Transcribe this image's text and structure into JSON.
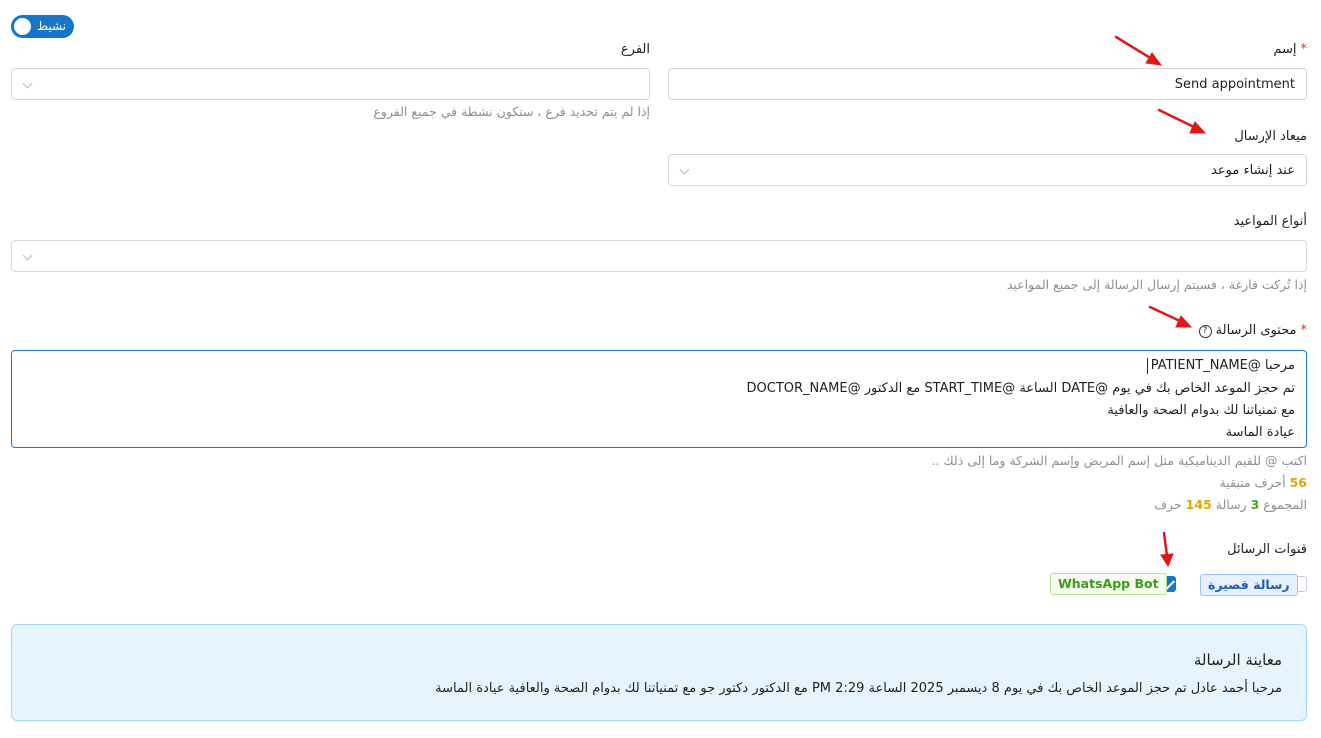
{
  "status_toggle": {
    "label": "نشيط",
    "on": true
  },
  "name_field": {
    "label": "إسم",
    "required_mark": "*",
    "value": "Send appointment"
  },
  "branch_field": {
    "label": "الفرع",
    "value": "",
    "hint": "إذا لم يتم تحديد فرع ، ستكون نشطة في جميع الفروع"
  },
  "send_time_field": {
    "label": "ميعاد الإرسال",
    "value": "عند إنشاء موعد"
  },
  "appointment_types_field": {
    "label": "أنواع المواعيد",
    "value": "",
    "hint": "إذا تُركت فارغة ، فسيتم إرسال الرسالة إلى جميع المواعيد"
  },
  "message_content": {
    "label": "محتوى الرسالة",
    "required_mark": "*",
    "help_icon": "question-circle-icon",
    "lines": [
      "مرحبا @PATIENT_NAME",
      "تم حجز الموعد الخاص بك في يوم @DATE الساعة @START_TIME مع الدكتور @DOCTOR_NAME",
      "مع تمنياتنا لك بدوام الصحة والعافية",
      "عيادة الماسة"
    ],
    "hint": "اكتب @ للقيم الديناميكية مثل إسم المريض وإسم الشركة وما إلى ذلك ..",
    "remaining_count": "56",
    "remaining_text": "أحرف متبقية",
    "total_prefix": "المجموع",
    "total_messages": "3",
    "messages_word": "رسالة",
    "total_chars": "145",
    "chars_word": "حرف"
  },
  "channels": {
    "label": "قنوات الرسائل",
    "items": [
      {
        "label": "رسالة قصيرة",
        "checked": false,
        "color": "blue"
      },
      {
        "label": "WhatsApp Bot",
        "checked": true,
        "color": "green"
      }
    ]
  },
  "preview": {
    "title": "معاينة الرسالة",
    "text": "مرحبا أحمد عادل تم حجز الموعد الخاص بك في يوم 8 ديسمبر 2025 الساعة 2:29 PM مع الدكتور دكتور جو مع تمنياتنا لك بدوام الصحة والعافية عيادة الماسة"
  },
  "colors": {
    "primary": "#1677c9",
    "required": "#e0331e",
    "annotation_arrow": "#e3161b",
    "preview_bg": "#e7f4fe"
  }
}
